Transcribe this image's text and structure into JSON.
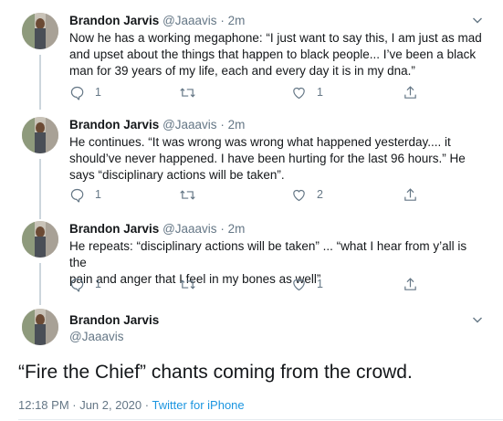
{
  "thread": [
    {
      "name": "Brandon Jarvis",
      "handle": "@Jaaavis",
      "separator": "·",
      "time": "2m",
      "lines": [
        "Now he has a working megaphone: “I just want to say this, I am just as mad",
        "and upset about the things that happen to black people... I’ve been a black",
        "man for 39 years of my life, each and every day it is in my dna.”"
      ],
      "reply_count": "1",
      "retweet_count": "",
      "like_count": "1"
    },
    {
      "name": "Brandon Jarvis",
      "handle": "@Jaaavis",
      "separator": "·",
      "time": "2m",
      "lines": [
        "He continues. “It was wrong was wrong what happened yesterday.... it",
        "should’ve never happened. I have been hurting for the last 96 hours.” He",
        "says “disciplinary actions will be taken”."
      ],
      "reply_count": "1",
      "retweet_count": "",
      "like_count": "2"
    },
    {
      "name": "Brandon Jarvis",
      "handle": "@Jaaavis",
      "separator": "·",
      "time": "2m",
      "lines": [
        "He repeats: “disciplinary actions will be taken” ... “what I hear from y’all is the",
        "pain and anger that I feel in my bones as well”"
      ],
      "reply_count": "1",
      "retweet_count": "",
      "like_count": "1"
    }
  ],
  "main": {
    "name": "Brandon Jarvis",
    "handle": "@Jaaavis",
    "text": "“Fire the Chief” chants coming from the crowd.",
    "date": "12:18 PM · Jun 2, 2020",
    "meta_separator": " · ",
    "source": "Twitter for iPhone"
  },
  "icons": {
    "reply": "reply-icon",
    "retweet": "retweet-icon",
    "like": "like-icon",
    "share": "share-icon",
    "more": "chevron-down-icon"
  },
  "colors": {
    "text": "#14171a",
    "secondary": "#657786",
    "link": "#1b95e0",
    "thread_line": "#ccd6dd"
  }
}
